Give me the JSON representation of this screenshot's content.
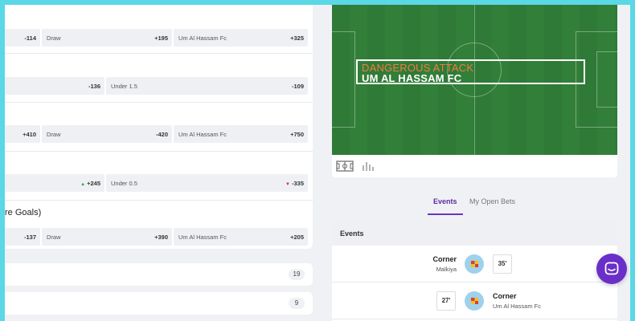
{
  "markets": [
    {
      "title": "",
      "odds": [
        {
          "label": "",
          "value": "-114"
        },
        {
          "label": "Draw",
          "value": "+195"
        },
        {
          "label": "Um Al Hassam Fc",
          "value": "+325"
        }
      ]
    },
    {
      "title": "",
      "odds": [
        {
          "label": "",
          "value": "-136"
        },
        {
          "label": "Under 1.5",
          "value": "-109"
        }
      ]
    },
    {
      "title": "",
      "odds": [
        {
          "label": "",
          "value": "+410"
        },
        {
          "label": "Draw",
          "value": "-420"
        },
        {
          "label": "Um Al Hassam Fc",
          "value": "+750"
        }
      ]
    },
    {
      "title": "",
      "odds": [
        {
          "label": "",
          "value": "+245",
          "trend": "up"
        },
        {
          "label": "Under 0.5",
          "value": "-335",
          "trend": "down"
        }
      ]
    },
    {
      "title": "re Goals)",
      "odds": [
        {
          "label": "",
          "value": "-137"
        },
        {
          "label": "Draw",
          "value": "+390"
        },
        {
          "label": "Um Al Hassam Fc",
          "value": "+205"
        }
      ]
    }
  ],
  "collapsed": [
    {
      "count": "19"
    },
    {
      "count": "9"
    }
  ],
  "field": {
    "event_type": "DANGEROUS ATTACK",
    "event_team": "UM AL HASSAM FC"
  },
  "tabs": {
    "events": "Events",
    "open_bets": "My Open Bets"
  },
  "events": {
    "header": "Events",
    "rows": [
      {
        "name": "Corner",
        "team": "Malkiya",
        "minute": "35'",
        "side": "home"
      },
      {
        "name": "Corner",
        "team": "Um Al Hassam Fc",
        "minute": "27'",
        "side": "away"
      }
    ]
  },
  "colors": {
    "accent": "#6a2fc8",
    "attack": "#f07c3e",
    "pitch": "#2f7a36"
  },
  "icons": {
    "pitch_view": "pitch-icon",
    "stats_view": "bar-chart-icon",
    "chat": "chat-icon",
    "corner": "corner-flag-icon"
  }
}
